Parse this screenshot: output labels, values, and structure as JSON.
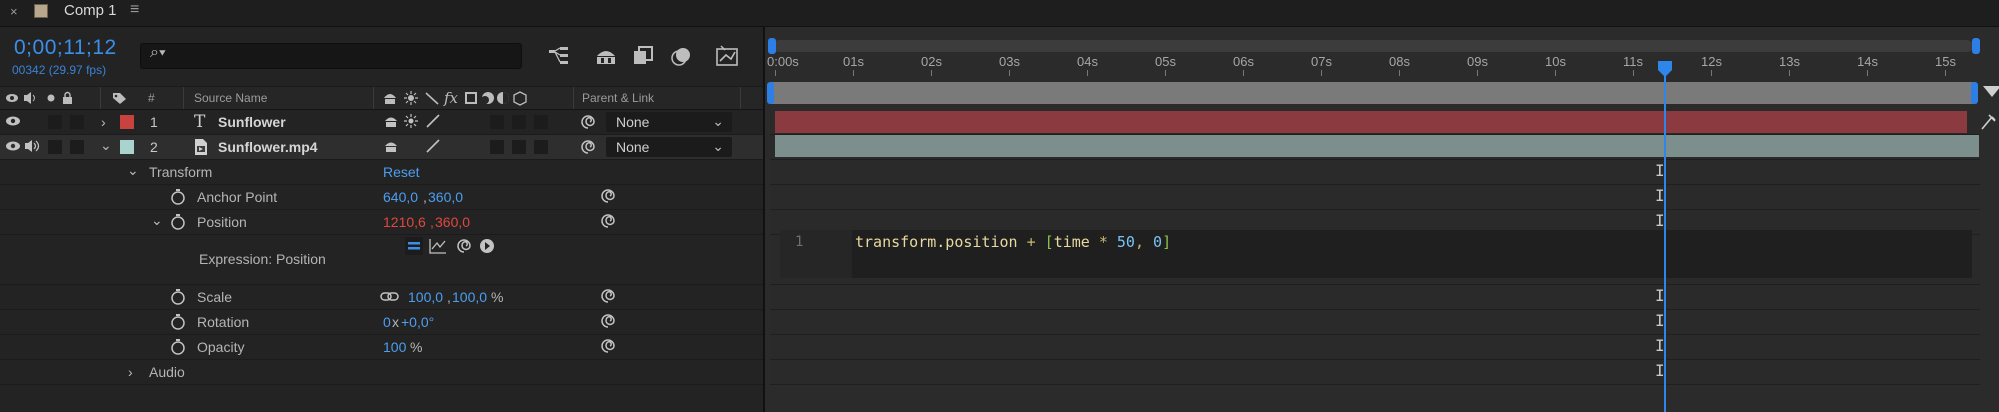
{
  "tab": {
    "close": "×",
    "title": "Comp 1",
    "menu": "≡"
  },
  "timecode": {
    "current": "0;00;11;12",
    "frames": "00342 (29.97 fps)"
  },
  "search": {
    "placeholder": ""
  },
  "columns": {
    "num": "#",
    "source_name": "Source Name",
    "parent": "Parent & Link"
  },
  "layers": [
    {
      "num": "1",
      "name": "Sunflower",
      "type_icon": "T",
      "label_color": "#c8423f",
      "parent": "None"
    },
    {
      "num": "2",
      "name": "Sunflower.mp4",
      "type_icon": "film",
      "label_color": "#a9d3cc",
      "parent": "None"
    }
  ],
  "transform": {
    "label": "Transform",
    "reset": "Reset",
    "anchor_point": {
      "label": "Anchor Point",
      "x": "640,0",
      "sep": ",",
      "y": "360,0"
    },
    "position": {
      "label": "Position",
      "x": "1210,6",
      "sep": ",",
      "y": "360,0"
    },
    "expression": {
      "label": "Expression: Position",
      "line": "1",
      "code_parts": [
        "transform.position",
        " + ",
        "[",
        "time",
        " * ",
        "50",
        ", ",
        "0",
        "]"
      ]
    },
    "scale": {
      "label": "Scale",
      "x": "100,0",
      "sep": ",",
      "y": "100,0",
      "unit": "%"
    },
    "rotation": {
      "label": "Rotation",
      "turns": "0",
      "x": "x",
      "deg": "+0,0°"
    },
    "opacity": {
      "label": "Opacity",
      "value": "100",
      "unit": "%"
    }
  },
  "audio": {
    "label": "Audio"
  },
  "ruler": {
    "labels": [
      "0:00s",
      "01s",
      "02s",
      "03s",
      "04s",
      "05s",
      "06s",
      "07s",
      "08s",
      "09s",
      "10s",
      "11s",
      "12s",
      "13s",
      "14s",
      "15s"
    ]
  },
  "playhead": {
    "time_seconds": 11.4
  },
  "colors": {
    "accent": "#2e86ea",
    "layer1_bar": "#8b3a3f",
    "layer2_bar": "#7d8f8c"
  }
}
